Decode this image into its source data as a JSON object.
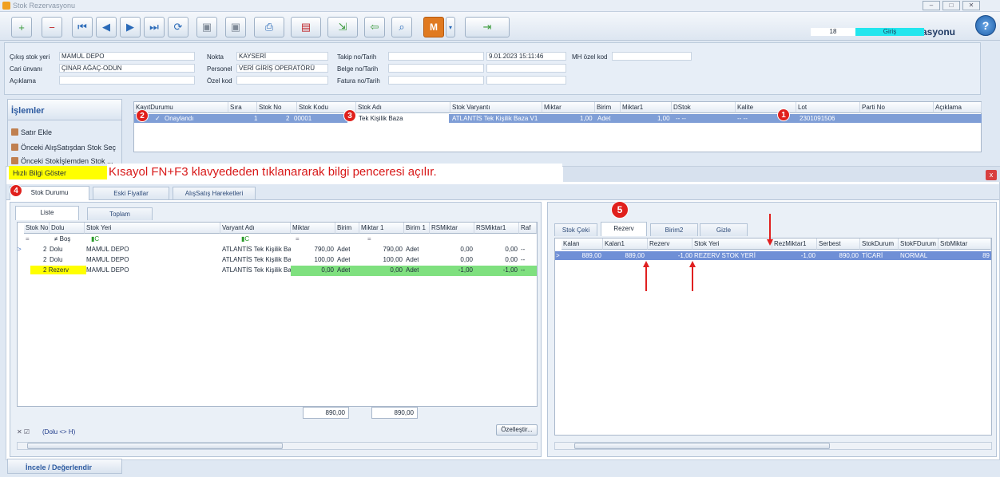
{
  "window": {
    "title": "Stok Rezervasyonu",
    "header_title": "Stok Rezervasyonu",
    "record_no": "18",
    "mode": "Giriş",
    "accent_color": "#22e6ee"
  },
  "toolbar": {
    "buttons": [
      "new-icon",
      "delete-icon",
      "first-icon",
      "prev-icon",
      "next-icon",
      "last-icon",
      "refresh-icon",
      "save-icon",
      "save-close-icon",
      "print-icon",
      "pdf-icon",
      "export-icon",
      "import-icon",
      "preview-icon",
      "m-icon",
      "exit-icon"
    ],
    "m_label": "M",
    "help_label": "?"
  },
  "form": {
    "cikis_stok_yeri_label": "Çıkış stok yeri",
    "cikis_stok_yeri_value": "MAMUL DEPO",
    "cari_unvani_label": "Cari ünvanı",
    "cari_unvani_value": "ÇINAR AĞAÇ-ODUN",
    "aciklama_label": "Açıklama",
    "aciklama_value": "",
    "nokta_label": "Nokta",
    "nokta_value": "KAYSERİ",
    "personel_label": "Personel",
    "personel_value": "VERİ GİRİŞ OPERATÖRÜ",
    "ozel_kod_label": "Özel kod",
    "ozel_kod_value": "",
    "takip_label": "Takip no/Tarih",
    "takip_date": "9.01.2023 15:11:46",
    "belge_label": "Belge no/Tarih",
    "fatura_label": "Fatura no/Tarih",
    "mh_label": "MH özel kod"
  },
  "side": {
    "title": "İşlemler",
    "items": [
      "Satır Ekle",
      "Önceki AlışSatışdan Stok Seç",
      "Önceki Stokİşlemden Stok ..."
    ],
    "highlight_item": "Hızlı Bilgi Göster",
    "bottom_item": "İncele / Değerlendir"
  },
  "main_grid": {
    "headers": [
      "KayıtDurumu",
      "Sıra",
      "Stok No",
      "Stok Kodu",
      "Stok Adı",
      "Stok Varyantı",
      "Miktar",
      "Birim",
      "Miktar1",
      "DStok",
      "Kalite",
      "Lot",
      "Parti No",
      "Açıklama"
    ],
    "row": {
      "durum": "Onaylandı",
      "sira": "1",
      "stok_no": "2",
      "stok_kodu": "00001",
      "stok_adi": "Tek Kişilik Baza",
      "varyant": "ATLANTİS Tek Kişilik Baza V1",
      "miktar": "1,00",
      "birim": "Adet",
      "miktar1": "1,00",
      "dstok": "-- --",
      "kalite": "-- --",
      "lot": "2301091506"
    }
  },
  "note": "Kısayol FN+F3 klavyededen tıklanararak bilgi penceresi açılır.",
  "badges": [
    "1",
    "2",
    "3",
    "4",
    "5"
  ],
  "popup": {
    "close_label": "x",
    "tabs": [
      "Stok Durumu",
      "Eski Fiyatlar",
      "AlışSatış Hareketleri"
    ],
    "left_subtabs": [
      "Liste",
      "Toplam"
    ],
    "left_headers": [
      "Stok No",
      "Dolu",
      "Stok Yeri",
      "Varyant Adı",
      "Miktar",
      "Birim",
      "Miktar 1",
      "Birim 1",
      "RSMiktar",
      "RSMiktar1",
      "Raf"
    ],
    "filter": {
      "op1": "=",
      "op2": "≠ Boş",
      "op3": "=",
      "op4": "="
    },
    "left_rows": [
      {
        "stok_no": "2",
        "dolu": "Dolu",
        "stok_yeri": "MAMUL DEPO",
        "varyant": "ATLANTİS Tek Kişilik Ba",
        "miktar": "790,00",
        "birim": "Adet",
        "miktar1": "790,00",
        "birim1": "Adet",
        "rs": "0,00",
        "rs1": "0,00",
        "raf": "--"
      },
      {
        "stok_no": "2",
        "dolu": "Dolu",
        "stok_yeri": "MAMUL DEPO",
        "varyant": "ATLANTİS Tek Kişilik Ba",
        "miktar": "100,00",
        "birim": "Adet",
        "miktar1": "100,00",
        "birim1": "Adet",
        "rs": "0,00",
        "rs1": "0,00",
        "raf": "--"
      },
      {
        "stok_no": "2",
        "dolu": "Rezerv",
        "stok_yeri": "MAMUL DEPO",
        "varyant": "ATLANTİS Tek Kişilik Ba",
        "miktar": "0,00",
        "birim": "Adet",
        "miktar1": "0,00",
        "birim1": "Adet",
        "rs": "-1,00",
        "rs1": "-1,00",
        "raf": "--"
      }
    ],
    "sum_miktar": "890,00",
    "sum_miktar1": "890,00",
    "filter_text": "(Dolu <> H)",
    "ozellestir": "Özelleştir...",
    "right_tabs": [
      "Stok Çeki",
      "Rezerv",
      "Birim2",
      "Gizle"
    ],
    "right_headers": [
      "Kalan",
      "Kalan1",
      "Rezerv",
      "Stok Yeri",
      "RezMiktar1",
      "Serbest",
      "StokDurum",
      "StokFDurum",
      "SrbMiktar"
    ],
    "right_row": {
      "kalan": "889,00",
      "kalan1": "889,00",
      "rezerv": "-1,00",
      "stok_yeri": "REZERV STOK YERİ",
      "rezmiktar1": "-1,00",
      "serbest": "890,00",
      "stokdurum": "TİCARİ",
      "stokfdurum": "NORMAL",
      "srb": "89"
    }
  }
}
